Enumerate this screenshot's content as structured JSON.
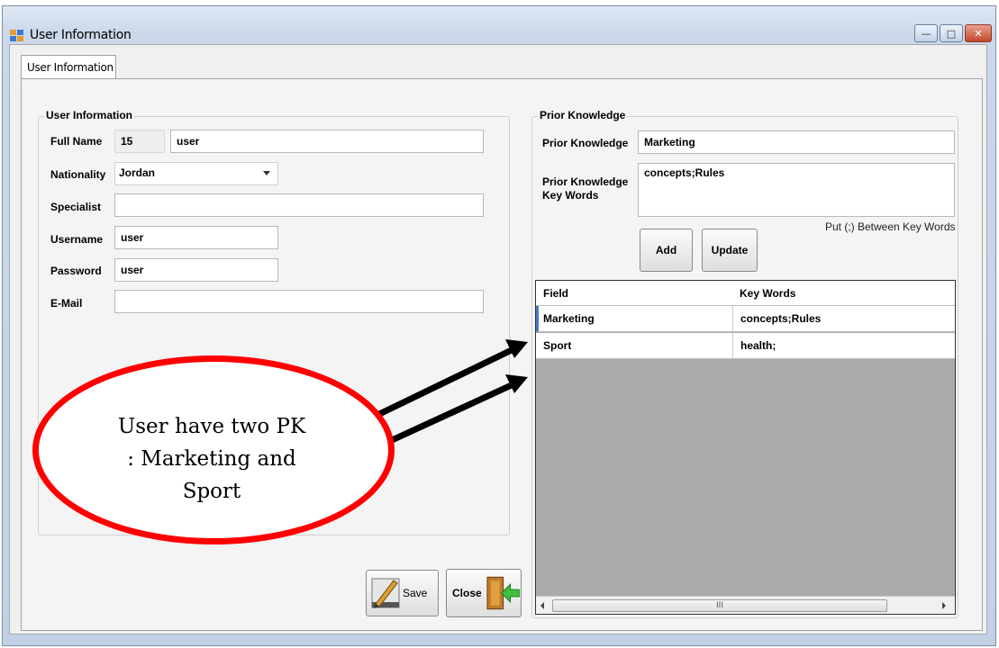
{
  "window": {
    "title": "User Information",
    "tab": "User Information"
  },
  "user_info": {
    "group_title": "User Information",
    "full_name_label": "Full Name",
    "id_value": "15",
    "full_name_value": "user",
    "nationality_label": "Nationality",
    "nationality_value": "Jordan",
    "specialist_label": "Specialist",
    "specialist_value": "",
    "username_label": "Username",
    "username_value": "user",
    "password_label": "Password",
    "password_value": "user",
    "email_label": "E-Mail",
    "email_value": ""
  },
  "prior_knowledge": {
    "group_title": "Prior Knowledge",
    "pk_label": "Prior Knowledge",
    "pk_value": "Marketing",
    "keywords_label_1": "Prior Knowledge",
    "keywords_label_2": "Key Words",
    "keywords_value": "concepts;Rules",
    "hint": "Put (;) Between Key Words",
    "add_label": "Add",
    "update_label": "Update"
  },
  "grid": {
    "columns": [
      "Field",
      "Key Words"
    ],
    "rows": [
      {
        "field": "Marketing",
        "keywords": "concepts;Rules"
      },
      {
        "field": "Sport",
        "keywords": "health;"
      }
    ],
    "scroll_grip": "III"
  },
  "buttons": {
    "save_label": "Save",
    "close_label": "Close"
  },
  "callout": {
    "line1": "User have two PK",
    "line2": ": Marketing and",
    "line3": "Sport"
  },
  "colors": {
    "callout_border": "#ff0000",
    "grid_background": "#aaaaaa"
  }
}
